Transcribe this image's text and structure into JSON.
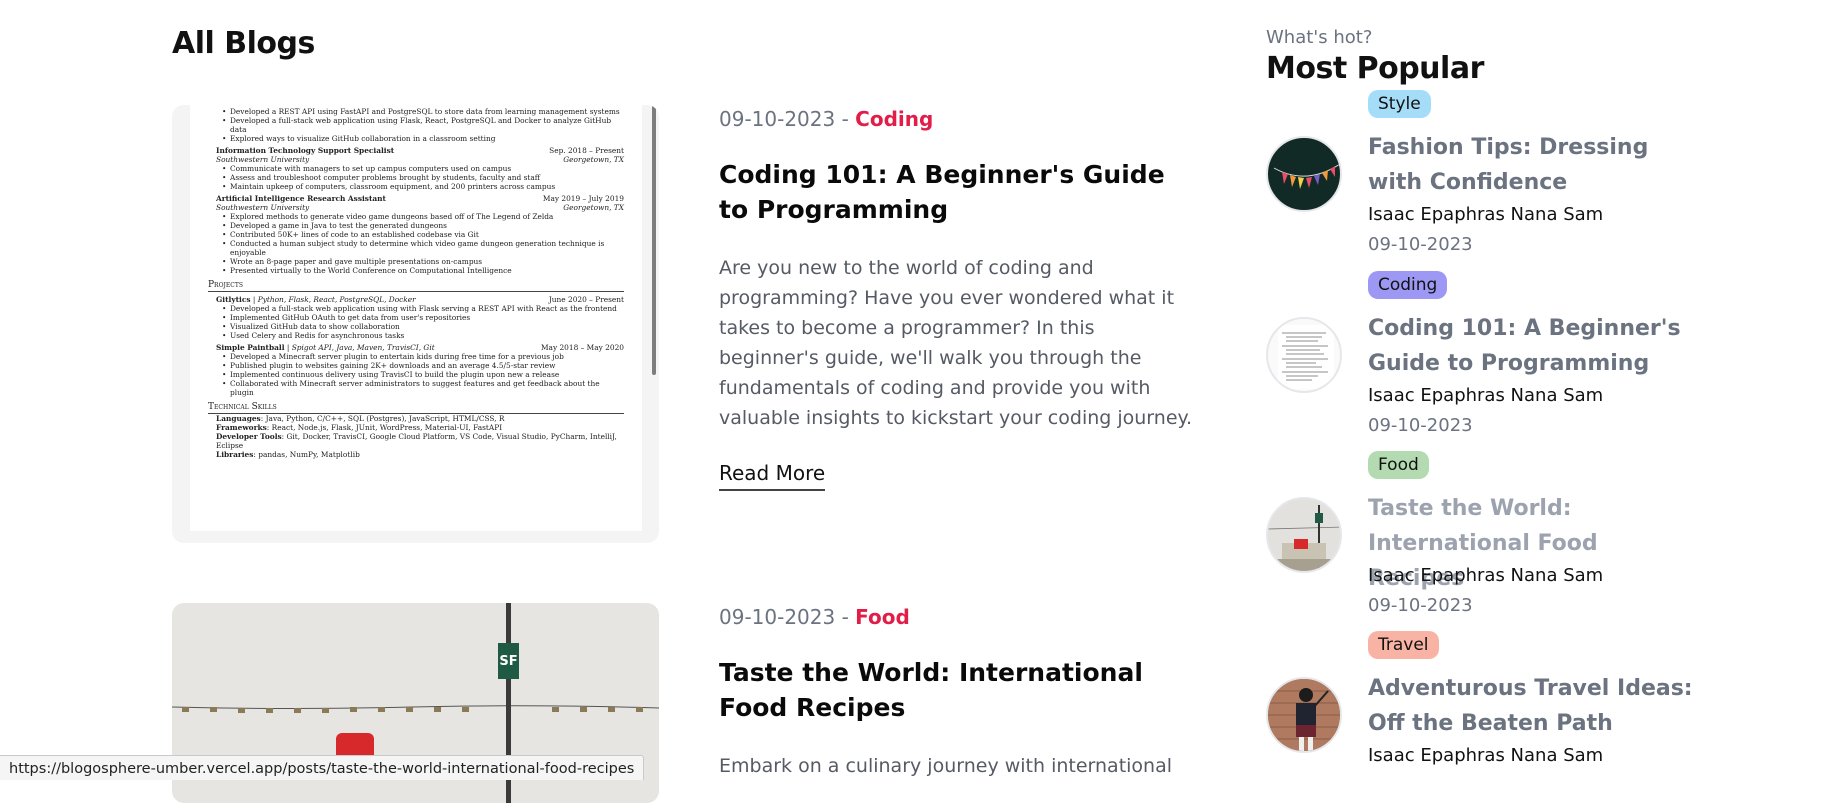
{
  "page": {
    "title": "All Blogs"
  },
  "posts": [
    {
      "date": "09-10-2023",
      "separator": "-",
      "category": "Coding",
      "title": "Coding 101: A Beginner's Guide to Programming",
      "excerpt": "Are you new to the world of coding and programming? Have you ever wondered what it takes to become a programmer? In this beginner's guide, we'll walk you through the fundamentals of coding and provide you with valuable insights to kickstart your coding journey.",
      "read_more": "Read More",
      "thumbnail": {
        "kind": "resume-document",
        "bullets_top": [
          "Developed a REST API using FastAPI and PostgreSQL to store data from learning management systems",
          "Developed a full-stack web application using Flask, React, PostgreSQL and Docker to analyze GitHub data",
          "Explored ways to visualize GitHub collaboration in a classroom setting"
        ],
        "jobs": [
          {
            "role": "Information Technology Support Specialist",
            "dates": "Sep. 2018 – Present",
            "org": "Southwestern University",
            "place": "Georgetown, TX",
            "bullets": [
              "Communicate with managers to set up campus computers used on campus",
              "Assess and troubleshoot computer problems brought by students, faculty and staff",
              "Maintain upkeep of computers, classroom equipment, and 200 printers across campus"
            ]
          },
          {
            "role": "Artificial Intelligence Research Assistant",
            "dates": "May 2019 – July 2019",
            "org": "Southwestern University",
            "place": "Georgetown, TX",
            "bullets": [
              "Explored methods to generate video game dungeons based off of The Legend of Zelda",
              "Developed a game in Java to test the generated dungeons",
              "Contributed 50K+ lines of code to an established codebase via Git",
              "Conducted a human subject study to determine which video game dungeon generation technique is enjoyable",
              "Wrote an 8-page paper and gave multiple presentations on-campus",
              "Presented virtually to the World Conference on Computational Intelligence"
            ]
          }
        ],
        "projects_heading": "Projects",
        "projects": [
          {
            "name": "Gitlytics",
            "stack": "Python, Flask, React, PostgreSQL, Docker",
            "dates": "June 2020 – Present",
            "bullets": [
              "Developed a full-stack web application using with Flask serving a REST API with React as the frontend",
              "Implemented GitHub OAuth to get data from user's repositories",
              "Visualized GitHub data to show collaboration",
              "Used Celery and Redis for asynchronous tasks"
            ]
          },
          {
            "name": "Simple Paintball",
            "stack": "Spigot API, Java, Maven, TravisCI, Git",
            "dates": "May 2018 – May 2020",
            "bullets": [
              "Developed a Minecraft server plugin to entertain kids during free time for a previous job",
              "Published plugin to websites gaining 2K+ downloads and an average 4.5/5-star review",
              "Implemented continuous delivery using TravisCI to build the plugin upon new a release",
              "Collaborated with Minecraft server administrators to suggest features and get feedback about the plugin"
            ]
          }
        ],
        "skills_heading": "Technical Skills",
        "skills": [
          {
            "label": "Languages",
            "value": "Java, Python, C/C++, SQL (Postgres), JavaScript, HTML/CSS, R"
          },
          {
            "label": "Frameworks",
            "value": "React, Node.js, Flask, JUnit, WordPress, Material-UI, FastAPI"
          },
          {
            "label": "Developer Tools",
            "value": "Git, Docker, TravisCI, Google Cloud Platform, VS Code, Visual Studio, PyCharm, IntelliJ, Eclipse"
          },
          {
            "label": "Libraries",
            "value": "pandas, NumPy, Matplotlib"
          }
        ]
      }
    },
    {
      "date": "09-10-2023",
      "separator": "-",
      "category": "Food",
      "title": "Taste the World: International Food Recipes",
      "excerpt": "Embark on a culinary journey with international",
      "thumbnail": {
        "kind": "street-photo",
        "sign_text": "SF"
      }
    }
  ],
  "sidebar": {
    "kicker": "What's hot?",
    "heading": "Most Popular",
    "items": [
      {
        "tag": "Style",
        "tag_color": "#a5dcf8",
        "title": "Fashion Tips: Dressing with Confidence",
        "author": "Isaac Epaphras Nana Sam",
        "date": "09-10-2023",
        "avatar": "bunting-flags"
      },
      {
        "tag": "Coding",
        "tag_color": "#9d98f4",
        "title": "Coding 101: A Beginner's Guide to Programming",
        "author": "Isaac Epaphras Nana Sam",
        "date": "09-10-2023",
        "avatar": "resume-doc"
      },
      {
        "tag": "Food",
        "tag_color": "#b3dab0",
        "title": "Taste the World: International Food Recipes",
        "author": "Isaac Epaphras Nana Sam",
        "date": "09-10-2023",
        "avatar": "street-scene"
      },
      {
        "tag": "Travel",
        "tag_color": "#f8b3a4",
        "title": "Adventurous Travel Ideas: Off the Beaten Path",
        "author": "Isaac Epaphras Nana Sam",
        "avatar": "bagpiper"
      }
    ]
  },
  "status_bar": {
    "url": "https://blogosphere-umber.vercel.app/posts/taste-the-world-international-food-recipes"
  },
  "colors": {
    "category": "#e11d48",
    "muted": "#6b7280"
  }
}
